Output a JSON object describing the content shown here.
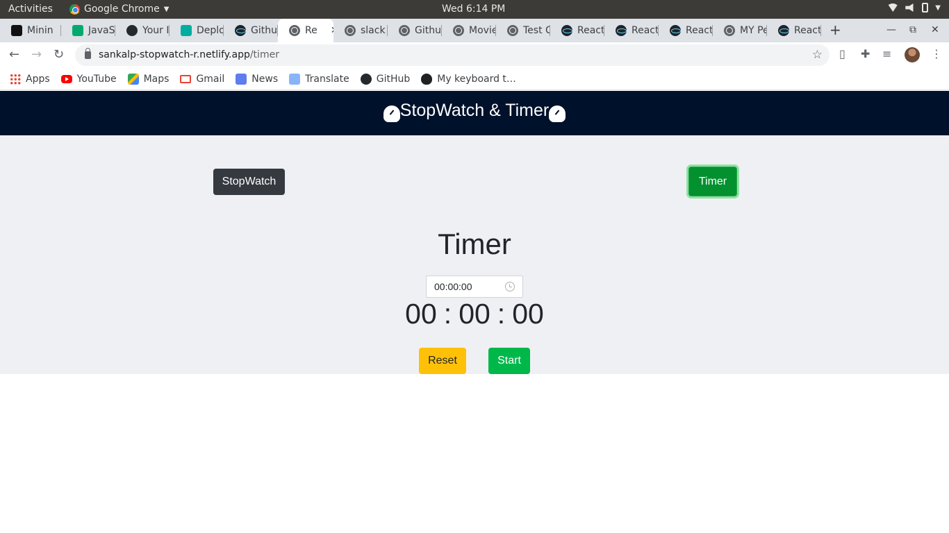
{
  "os_bar": {
    "activities": "Activities",
    "app_name": "Google Chrome",
    "clock": "Wed  6:14 PM"
  },
  "tabs": [
    {
      "title": "Minin",
      "icon": "notion-icon",
      "color": "#111111"
    },
    {
      "title": "JavaS",
      "icon": "w3-icon",
      "color": "#04aa6d"
    },
    {
      "title": "Your I",
      "icon": "github-icon",
      "color": "#24292e"
    },
    {
      "title": "Deplo",
      "icon": "netlify-icon",
      "color": "#00ad9f"
    },
    {
      "title": "Githu",
      "icon": "react-icon",
      "color": "#20232a"
    },
    {
      "title": "Re",
      "icon": "globe-icon",
      "color": "#5f6368",
      "active": true
    },
    {
      "title": "slack",
      "icon": "globe-icon",
      "color": "#5f6368"
    },
    {
      "title": "Githu",
      "icon": "globe-icon",
      "color": "#5f6368"
    },
    {
      "title": "Movie",
      "icon": "globe-icon",
      "color": "#5f6368"
    },
    {
      "title": "Test C",
      "icon": "globe-icon",
      "color": "#5f6368"
    },
    {
      "title": "React",
      "icon": "react-icon",
      "color": "#20232a"
    },
    {
      "title": "React",
      "icon": "react-icon",
      "color": "#20232a"
    },
    {
      "title": "React",
      "icon": "react-icon",
      "color": "#20232a"
    },
    {
      "title": "MY Pe",
      "icon": "globe-icon",
      "color": "#5f6368"
    },
    {
      "title": "React",
      "icon": "react-icon",
      "color": "#20232a"
    }
  ],
  "address_bar": {
    "host": "sankalp-stopwatch-r.netlify.app",
    "path": "/timer"
  },
  "bookmarks": [
    {
      "label": "Apps",
      "icon": "apps-grid-icon"
    },
    {
      "label": "YouTube",
      "icon": "youtube-icon"
    },
    {
      "label": "Maps",
      "icon": "maps-icon"
    },
    {
      "label": "Gmail",
      "icon": "gmail-icon"
    },
    {
      "label": "News",
      "icon": "news-icon"
    },
    {
      "label": "Translate",
      "icon": "translate-icon"
    },
    {
      "label": "GitHub",
      "icon": "github-icon"
    },
    {
      "label": "My keyboard t…",
      "icon": "paw-icon"
    }
  ],
  "app": {
    "header_title": "StopWatch & Timer",
    "nav": {
      "stopwatch": "StopWatch",
      "timer": "Timer"
    },
    "section_title": "Timer",
    "time_input_value": "00:00:00",
    "display": {
      "hours": "00",
      "minutes": "00",
      "seconds": "00",
      "separator": ":"
    },
    "buttons": {
      "reset": "Reset",
      "start": "Start"
    },
    "colors": {
      "header_bg": "#00112b",
      "body_bg": "#eff0f4",
      "stopwatch_btn": "#343a40",
      "timer_btn": "#039130",
      "reset_btn": "#ffc107",
      "start_btn": "#00b84a"
    }
  }
}
